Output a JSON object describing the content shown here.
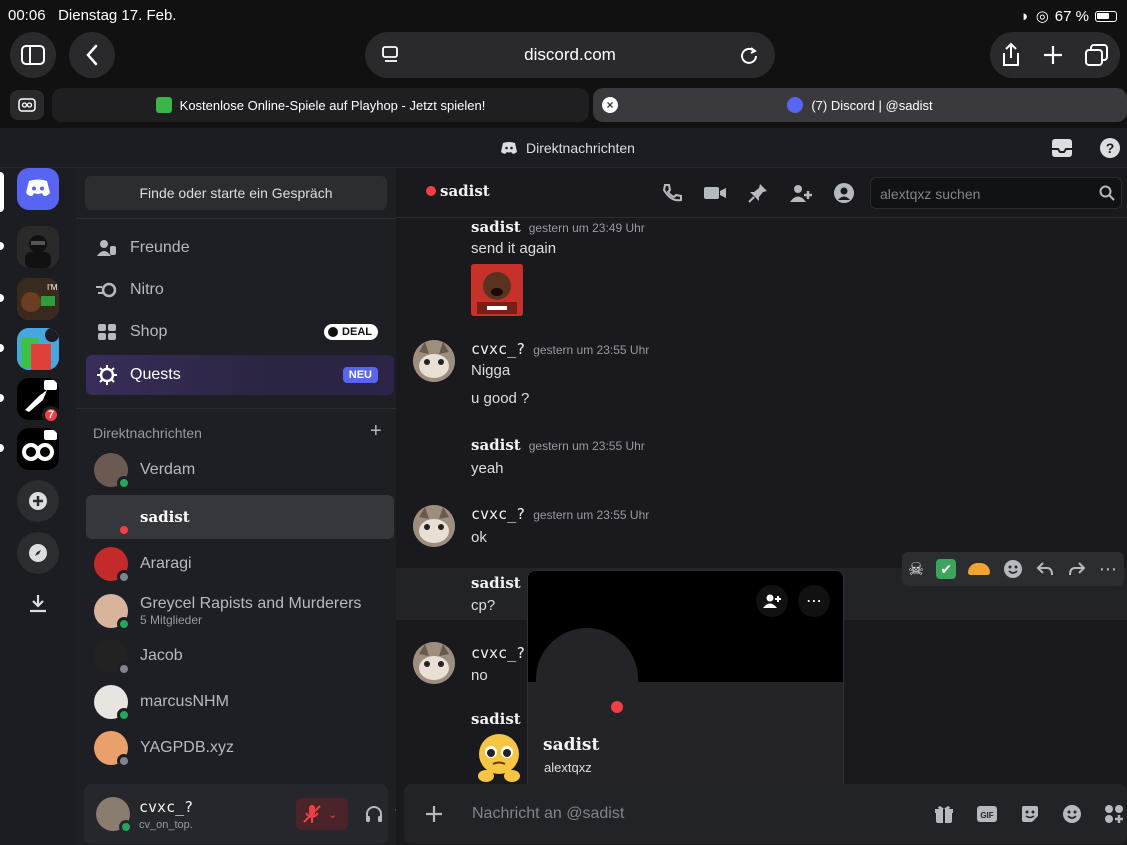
{
  "statusbar": {
    "time": "00:06",
    "date": "Dienstag 17. Feb.",
    "battery": "67 %"
  },
  "browser": {
    "url": "discord.com",
    "tabs": [
      {
        "title": "Kostenlose Online-Spiele auf Playhop - Jetzt spielen!"
      },
      {
        "title": "(7) Discord | @sadist"
      }
    ]
  },
  "discord_header": {
    "title": "Direktnachrichten"
  },
  "servers": {
    "badge": "7"
  },
  "sidebar": {
    "search_button": "Finde oder starte ein Gespräch",
    "nav": [
      {
        "label": "Freunde"
      },
      {
        "label": "Nitro"
      },
      {
        "label": "Shop",
        "badge": "DEAL"
      },
      {
        "label": "Quests",
        "badge": "NEU"
      }
    ],
    "dm_header": "Direktnachrichten",
    "dms": [
      {
        "name": "Verdam",
        "status": "online"
      },
      {
        "name": "sadist",
        "status": "dnd"
      },
      {
        "name": "Araragi",
        "status": "offline"
      },
      {
        "name": "Greycel Rapists and Murderers",
        "sub": "5 Mitglieder"
      },
      {
        "name": "Jacob",
        "status": "offline"
      },
      {
        "name": "marcusNHM",
        "status": "online"
      },
      {
        "name": "YAGPDB.xyz",
        "status": "offline"
      }
    ]
  },
  "user_panel": {
    "name": "cvxc_?",
    "status_text": "cv_on_top."
  },
  "chat": {
    "recipient": "sadist",
    "search_placeholder": "alextqxz suchen",
    "messages": [
      {
        "author": "sadist",
        "time": "gestern um 23:49 Uhr",
        "lines": [
          "send it again"
        ]
      },
      {
        "author": "cvxc_?",
        "time": "gestern um 23:55 Uhr",
        "lines": [
          "Nigga",
          "u good ?"
        ]
      },
      {
        "author": "sadist",
        "time": "gestern um 23:55 Uhr",
        "lines": [
          "yeah"
        ]
      },
      {
        "author": "cvxc_?",
        "time": "gestern um 23:55 Uhr",
        "lines": [
          "ok"
        ]
      },
      {
        "author": "sadist",
        "lines": [
          "cp?"
        ]
      },
      {
        "author": "cvxc_?",
        "lines": [
          "no"
        ]
      },
      {
        "author": "sadist",
        "lines": []
      }
    ],
    "composer_placeholder": "Nachricht an @sadist"
  },
  "profile_popup": {
    "display_name": "sadist",
    "username": "alextqxz"
  },
  "colors": {
    "blurple": "#5865f2",
    "online": "#23a55a",
    "dnd": "#f23f43",
    "offline": "#80848e"
  }
}
